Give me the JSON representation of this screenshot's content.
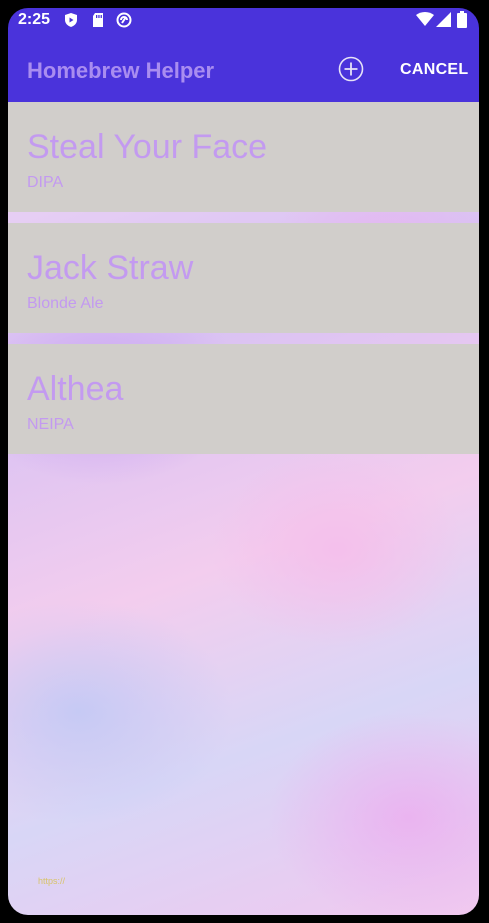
{
  "status_bar": {
    "time": "2:25",
    "icons": [
      "shield-icon",
      "sd-card-icon",
      "sync-icon",
      "wifi-icon",
      "signal-icon",
      "battery-icon"
    ]
  },
  "app_bar": {
    "title": "Homebrew Helper",
    "add_icon": "add-circle-icon",
    "cancel_label": "CANCEL"
  },
  "beers": [
    {
      "name": "Steal Your Face",
      "style": "DIPA"
    },
    {
      "name": "Jack Straw",
      "style": "Blonde Ale"
    },
    {
      "name": "Althea",
      "style": "NEIPA"
    }
  ],
  "watermark": "https://",
  "colors": {
    "primary": "#4a33db",
    "title_text": "#a98df0",
    "item_text": "#c39af0",
    "item_bg": "#d1cecb"
  }
}
